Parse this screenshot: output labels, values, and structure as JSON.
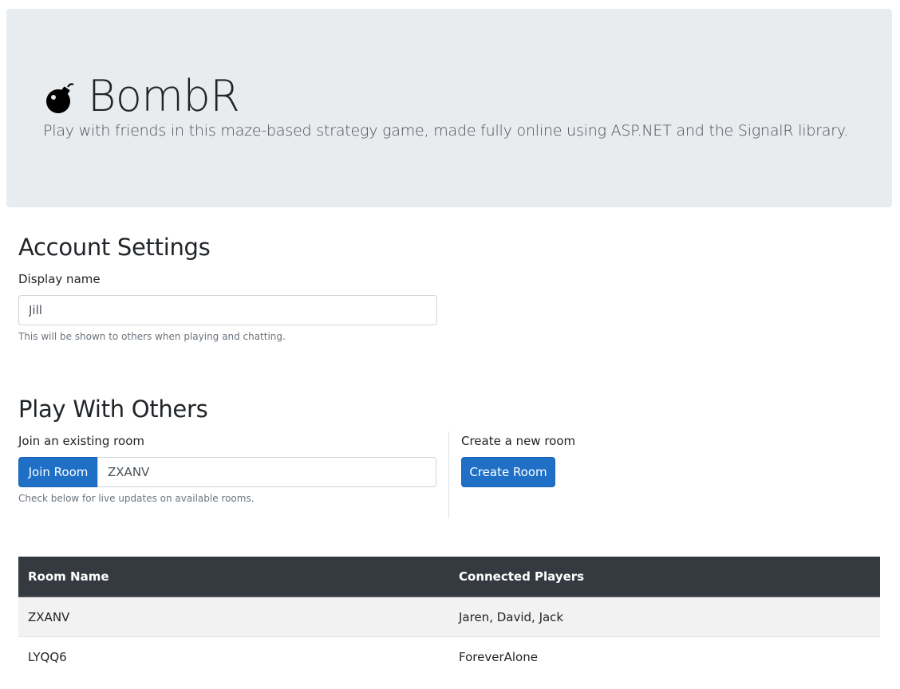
{
  "header": {
    "icon": "bomb-icon",
    "title": "BombR",
    "lead": "Play with friends in this maze-based strategy game, made fully online using ASP.NET and the SignalR library."
  },
  "account": {
    "heading": "Account Settings",
    "display_name_label": "Display name",
    "display_name_value": "Jill",
    "display_name_help": "This will be shown to others when playing and chatting."
  },
  "play": {
    "heading": "Play With Others",
    "join_label": "Join an existing room",
    "join_button": "Join Room",
    "room_code_value": "ZXANV",
    "join_help": "Check below for live updates on available rooms.",
    "create_label": "Create a new room",
    "create_button": "Create Room"
  },
  "rooms_table": {
    "columns": [
      "Room Name",
      "Connected Players"
    ],
    "rows": [
      {
        "room": "ZXANV",
        "players": "Jaren, David, Jack"
      },
      {
        "room": "LYQQ6",
        "players": "ForeverAlone"
      }
    ]
  },
  "colors": {
    "primary": "#1f6fc7",
    "jumbotron_bg": "#e9ecef",
    "table_header_bg": "#343a40"
  }
}
